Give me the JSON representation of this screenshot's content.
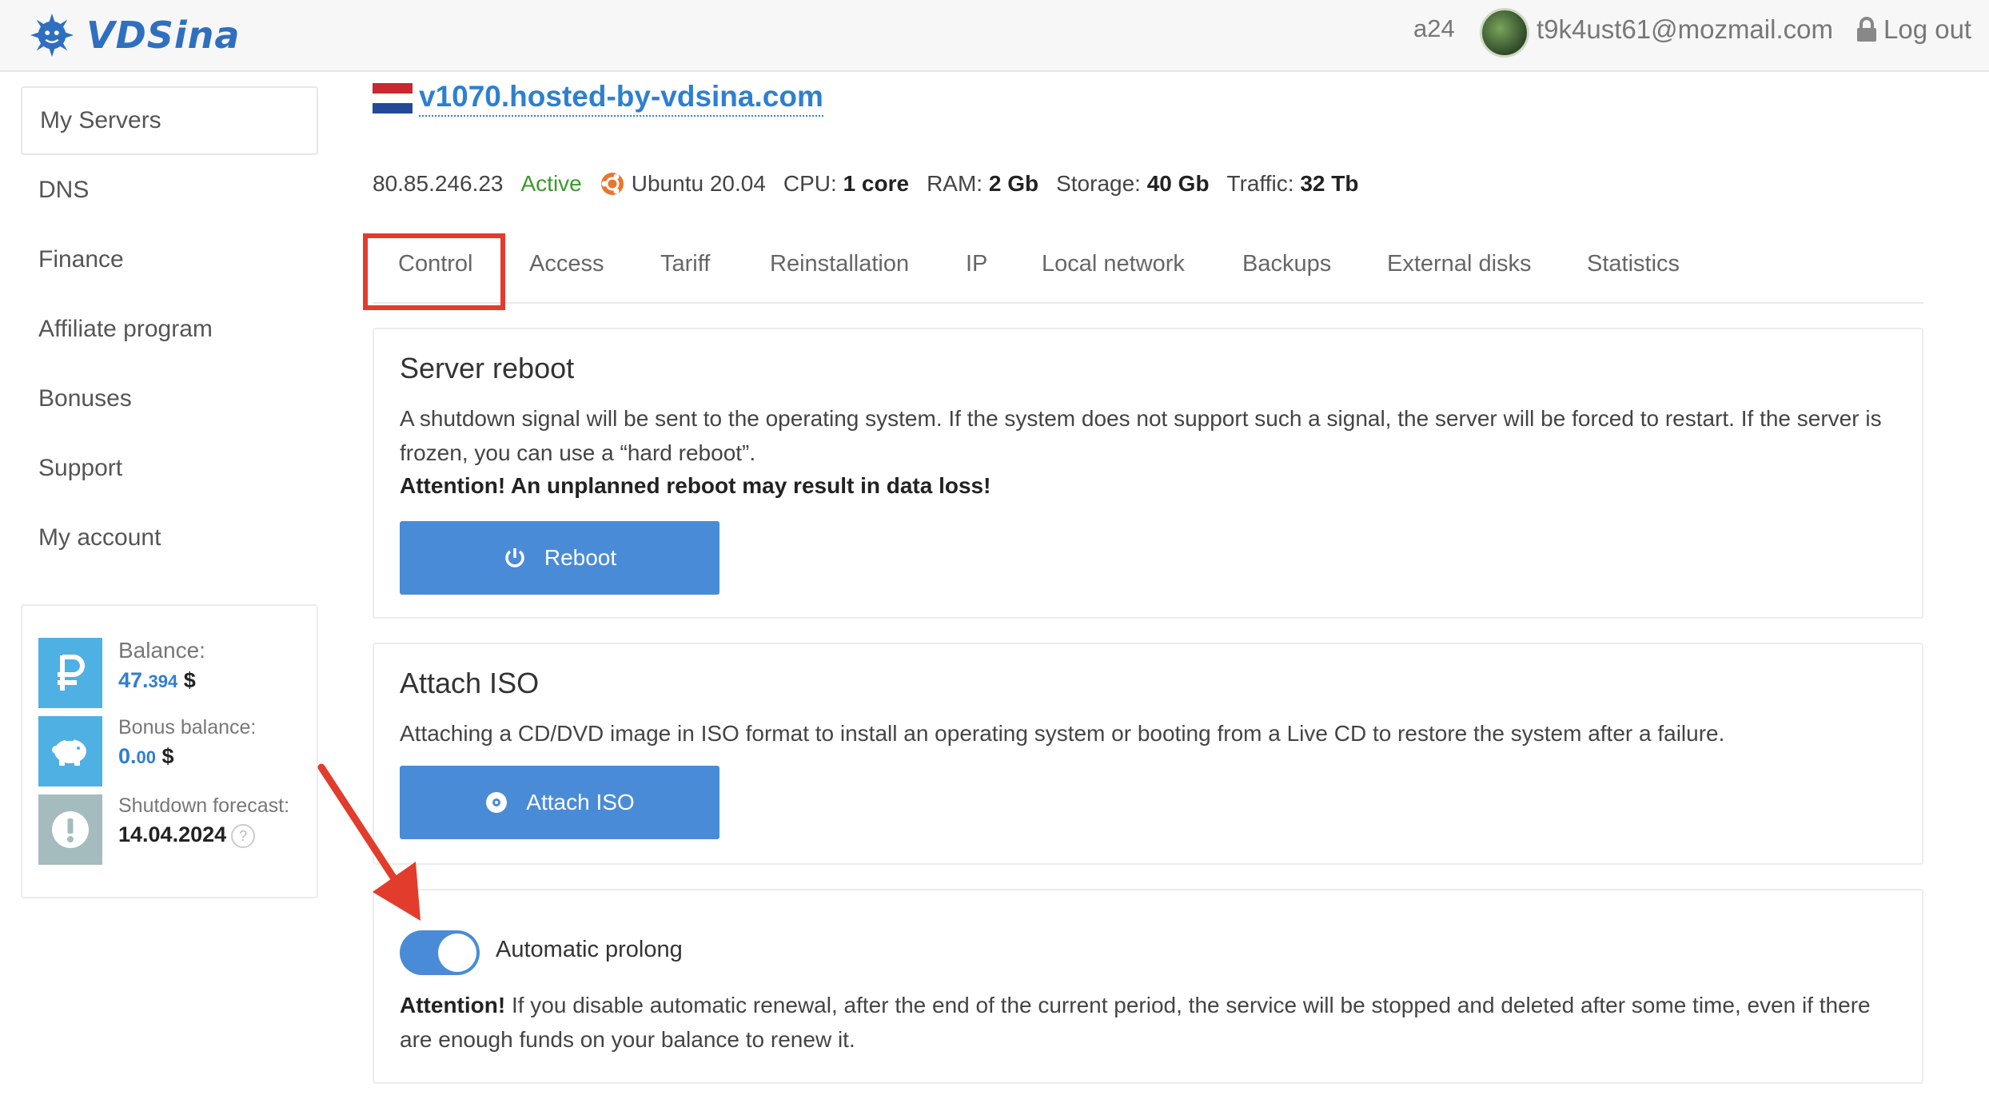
{
  "header": {
    "logo_text": "VDSina",
    "user_id": "a24",
    "email": "t9k4ust61@mozmail.com",
    "logout_label": "Log out"
  },
  "sidebar": {
    "items": [
      {
        "label": "My Servers"
      },
      {
        "label": "DNS"
      },
      {
        "label": "Finance"
      },
      {
        "label": "Affiliate program"
      },
      {
        "label": "Bonuses"
      },
      {
        "label": "Support"
      },
      {
        "label": "My account"
      }
    ],
    "balance": {
      "label": "Balance:",
      "value_int": "47.",
      "value_dec": "394",
      "currency": "$",
      "bonus_label": "Bonus balance:",
      "bonus_int": "0.",
      "bonus_dec": "00",
      "bonus_currency": "$",
      "forecast_label": "Shutdown forecast:",
      "forecast_date": "14.04.2024",
      "help": "?"
    }
  },
  "server": {
    "name": "v1070.hosted-by-vdsina.com",
    "ip": "80.85.246.23",
    "status": "Active",
    "os": "Ubuntu 20.04",
    "cpu_label": "CPU:",
    "cpu": "1 core",
    "ram_label": "RAM:",
    "ram": "2 Gb",
    "storage_label": "Storage:",
    "storage": "40 Gb",
    "traffic_label": "Traffic:",
    "traffic": "32 Tb"
  },
  "tabs": [
    {
      "label": "Control"
    },
    {
      "label": "Access"
    },
    {
      "label": "Tariff"
    },
    {
      "label": "Reinstallation"
    },
    {
      "label": "IP"
    },
    {
      "label": "Local network"
    },
    {
      "label": "Backups"
    },
    {
      "label": "External disks"
    },
    {
      "label": "Statistics"
    }
  ],
  "reboot": {
    "title": "Server reboot",
    "text": "A shutdown signal will be sent to the operating system. If the system does not support such a signal, the server will be forced to restart. If the server is frozen, you can use a “hard reboot”.",
    "warning": "Attention! An unplanned reboot may result in data loss!",
    "button": "Reboot"
  },
  "iso": {
    "title": "Attach ISO",
    "text": "Attaching a CD/DVD image in ISO format to install an operating system or booting from a Live CD to restore the system after a failure.",
    "button": "Attach ISO"
  },
  "prolong": {
    "label": "Automatic prolong",
    "enabled": true,
    "attention": "Attention!",
    "text": " If you disable automatic renewal, after the end of the current period, the service will be stopped and deleted after some time, even if there are enough funds on your balance to renew it."
  },
  "colors": {
    "accent": "#4a8bd8",
    "link": "#2f7fd0",
    "active": "#3a9a2c",
    "annotation": "#e23c2c"
  }
}
